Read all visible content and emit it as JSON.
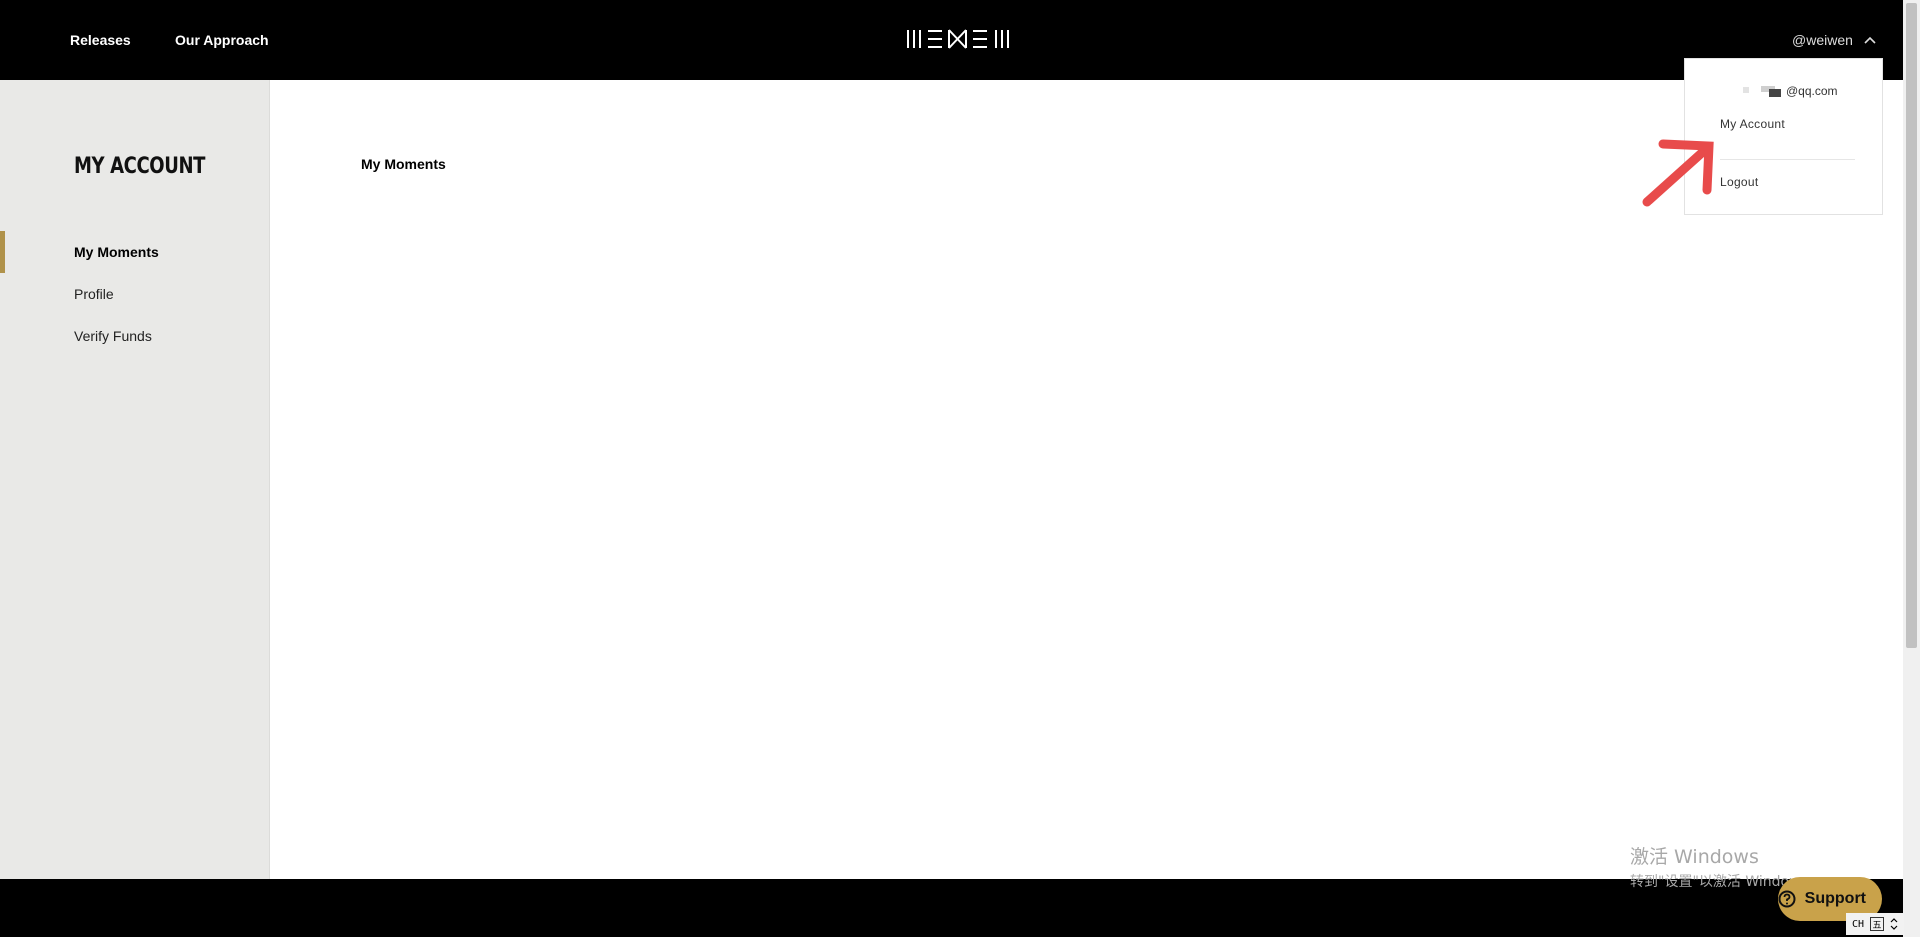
{
  "header": {
    "nav": [
      {
        "label": "Releases"
      },
      {
        "label": "Our Approach"
      }
    ],
    "username": "@weiwen"
  },
  "sidebar": {
    "title": "MY ACCOUNT",
    "items": [
      {
        "label": "My Moments",
        "active": true
      },
      {
        "label": "Profile",
        "active": false
      },
      {
        "label": "Verify Funds",
        "active": false
      }
    ]
  },
  "main": {
    "heading": "My Moments"
  },
  "dropdown": {
    "email": "@qq.com",
    "items": [
      {
        "label": "My Account"
      },
      {
        "label": "Logout"
      }
    ]
  },
  "support": {
    "label": "Support"
  },
  "watermark": {
    "line1": "激活 Windows",
    "line2": "转到\"设置\"以激活 Windows。"
  },
  "tray": {
    "lang": "CH",
    "ime": "五"
  },
  "colors": {
    "accent": "#b0924a",
    "support": "#c9a24a",
    "annotation": "#e84b4b"
  }
}
